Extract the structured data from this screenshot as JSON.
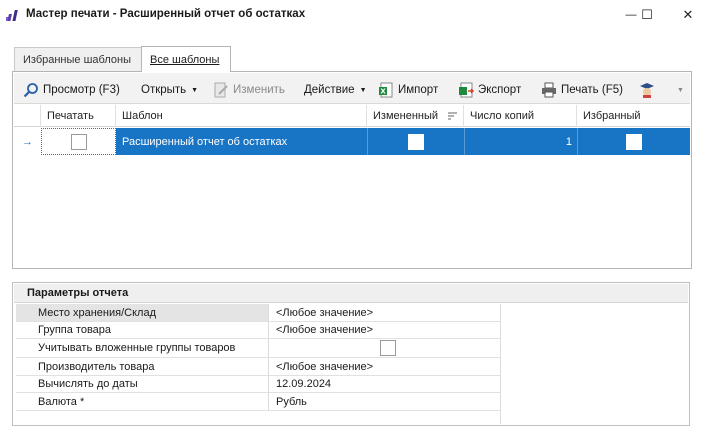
{
  "window": {
    "title": "Мастер печати - Расширенный отчет об остатках",
    "minimize_glyph": "—",
    "maximize_glyph": "☐",
    "close_glyph": "✕"
  },
  "tabs": [
    {
      "label": "Избранные шаблоны",
      "active": false
    },
    {
      "label": "Все шаблоны",
      "active": true
    }
  ],
  "toolbar": {
    "preview_label": "Просмотр (F3)",
    "open_label": "Открыть",
    "edit_label": "Изменить",
    "action_label": "Действие",
    "import_label": "Импорт",
    "export_label": "Экспорт",
    "print_label": "Печать (F5)"
  },
  "grid": {
    "columns": [
      "Печатать",
      "Шаблон",
      "Измененный",
      "Число копий",
      "Избранный"
    ],
    "rows": [
      {
        "print": false,
        "template": "Расширенный отчет об остатках",
        "modified": false,
        "copies": "1",
        "favorite": false,
        "selected": true
      }
    ]
  },
  "params": {
    "title": "Параметры отчета",
    "rows": [
      {
        "label": "Место хранения/Склад",
        "value": "<Любое значение>"
      },
      {
        "label": "Группа товара",
        "value": "<Любое значение>"
      },
      {
        "label": "Учитывать вложенные группы товаров",
        "value": ""
      },
      {
        "label": "Производитель товара",
        "value": "<Любое значение>"
      },
      {
        "label": "Вычислять до даты",
        "value": "12.09.2024"
      },
      {
        "label": "Валюта *",
        "value": "Рубль"
      }
    ]
  },
  "colors": {
    "selection": "#1874c4",
    "accent": "#5b3fa8"
  }
}
